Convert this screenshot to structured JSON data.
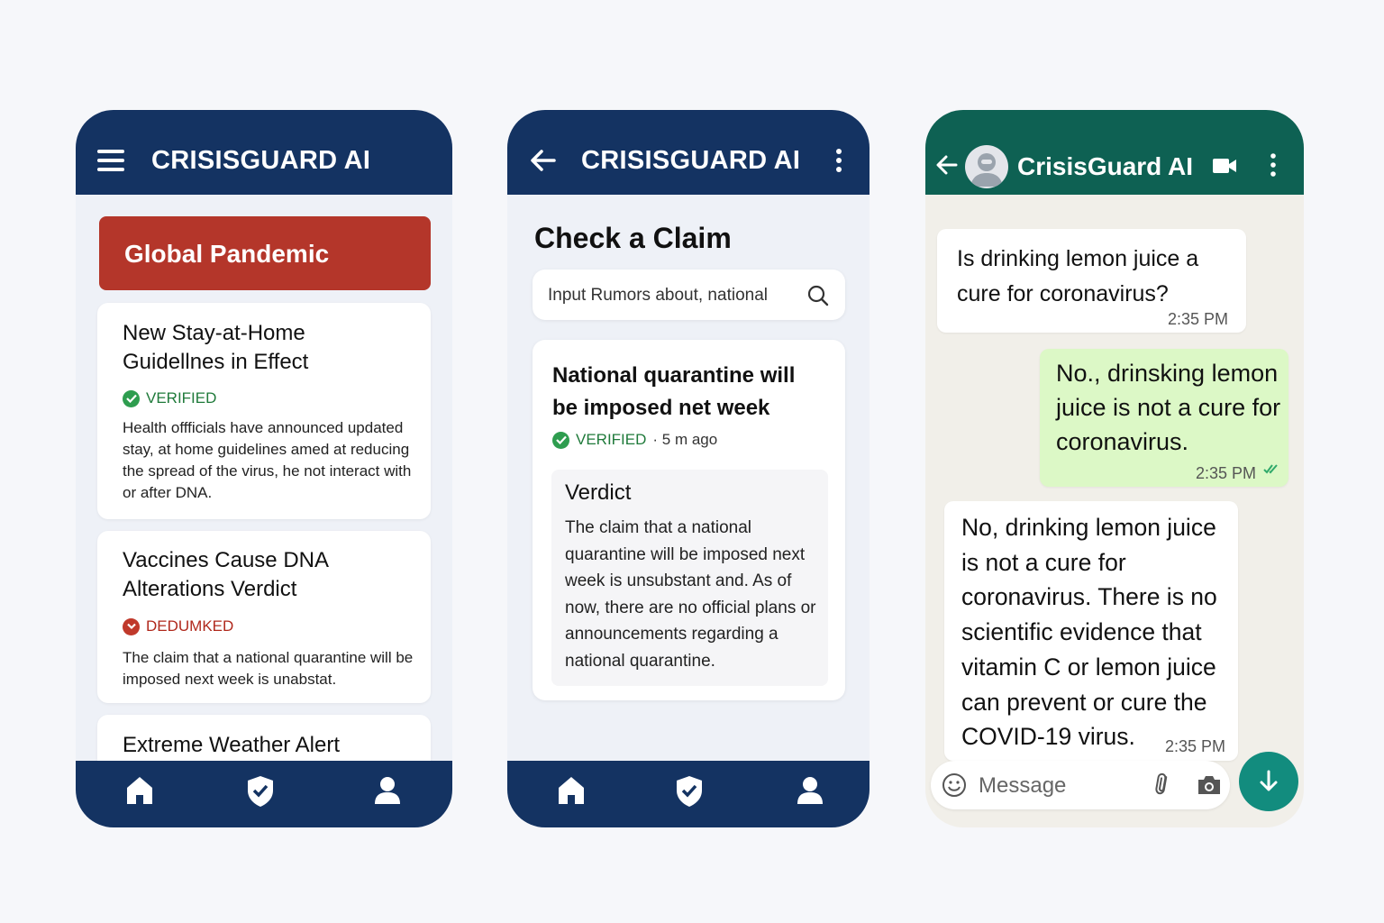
{
  "screen1": {
    "title": "CRISISGUARD AI",
    "banner": "Global Pandemic",
    "cards": [
      {
        "title": "New Stay-at-Home Guidellnes in Effect",
        "status": "VERIFIED",
        "body": "Health offficials have announced updated stay, at home guidelines amed at reducing the spread of the virus, he not interact with or after DNA."
      },
      {
        "title": "Vaccines Cause DNA Alterations Verdict",
        "status": "DEDUMKED",
        "body": "The claim that a national quarantine will be imposed next week is unabstat."
      },
      {
        "title": "Extreme Weather Alert"
      }
    ]
  },
  "screen2": {
    "title": "CRISISGUARD AI",
    "heading": "Check a Claim",
    "search_placeholder": "Input Rumors about, national",
    "claim": {
      "title": "National quarantine will be imposed  net week",
      "status": "VERIFIED",
      "meta": "· 5 m ago",
      "verdict_title": "Verdict",
      "verdict_body": "The claim that a national quarantine will be imposed next week is unsubstant and. As of now, there are no official plans or announcements regarding a national quarantine."
    }
  },
  "screen3": {
    "contact": "CrisisGuard AI",
    "messages": [
      {
        "text": "Is drinking lemon juice a cure for coronavirus?",
        "time": "2:35 PM"
      },
      {
        "text": "No., drinsking lemon juice is not a cure for coronavirus.",
        "time": "2:35 PM"
      },
      {
        "text": "No, drinking lemon juice is not a cure for coronavirus. There is no scientific evidence that vitamin C or lemon juice can prevent or cure the COVID-19 virus.",
        "time": "2:35 PM"
      }
    ],
    "input_placeholder": "Message"
  },
  "icons": [
    "menu-icon",
    "back-icon",
    "more-icon",
    "home-icon",
    "shield-check-icon",
    "person-icon",
    "search-icon",
    "check-circle-icon",
    "x-circle-icon",
    "avatar-icon",
    "video-call-icon",
    "emoji-icon",
    "attach-icon",
    "camera-icon",
    "mic-icon",
    "double-check-icon"
  ],
  "colors": {
    "navy": "#143362",
    "alert_red": "#b4362a",
    "verified_green": "#2e9d4f",
    "debunked_red": "#c0392b",
    "whatsapp_green": "#0e6153",
    "outgoing_bubble": "#dcf8c6",
    "fab_teal": "#128c7e"
  }
}
